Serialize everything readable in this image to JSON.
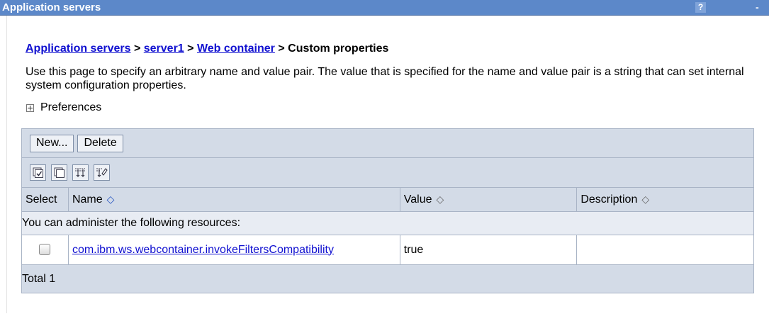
{
  "header": {
    "title": "Application servers",
    "help_label": "?",
    "minimize_label": "-"
  },
  "breadcrumb": {
    "items": [
      "Application servers",
      "server1",
      "Web container"
    ],
    "separator": ">",
    "current": "Custom properties"
  },
  "description": "Use this page to specify an arbitrary name and value pair. The value that is specified for the name and value pair is a string that can set internal system configuration properties.",
  "preferences": {
    "label": "Preferences",
    "expanded": false
  },
  "toolbar": {
    "new_label": "New...",
    "delete_label": "Delete",
    "icons": [
      "select-all-icon",
      "deselect-all-icon",
      "show-filter-icon",
      "clear-filter-icon"
    ]
  },
  "table": {
    "columns": [
      {
        "label": "Select"
      },
      {
        "label": "Name",
        "sort": "ascending"
      },
      {
        "label": "Value",
        "sort": "none"
      },
      {
        "label": "Description",
        "sort": "none"
      }
    ],
    "sort_glyph": "◇",
    "info_text": "You can administer the following resources:",
    "rows": [
      {
        "selected": false,
        "name": "com.ibm.ws.webcontainer.invokeFiltersCompatibility",
        "value": "true",
        "description": ""
      }
    ],
    "total_label": "Total 1"
  },
  "colors": {
    "title_bar": "#5c88c9",
    "link": "#1010d0",
    "table_bar": "#d3dbe7"
  }
}
